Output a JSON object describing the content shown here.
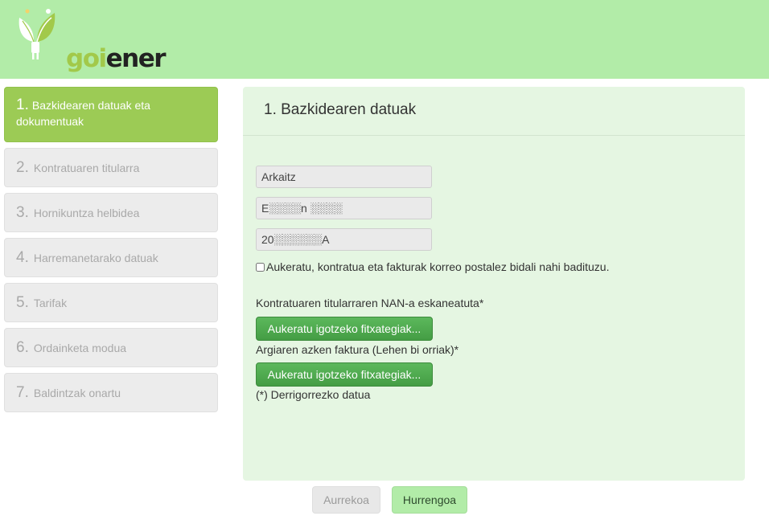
{
  "header": {
    "logo_text_goi": "goi",
    "logo_text_ener": "ener",
    "brand_colors": {
      "green_light": "#b2eca8",
      "green_logo": "#a2c94a",
      "active_step": "#9ccb55"
    }
  },
  "steps": [
    {
      "num": "1.",
      "label": "Bazkidearen datuak eta dokumentuak",
      "active": true
    },
    {
      "num": "2.",
      "label": "Kontratuaren titularra",
      "active": false
    },
    {
      "num": "3.",
      "label": "Hornikuntza helbidea",
      "active": false
    },
    {
      "num": "4.",
      "label": "Harremanetarako datuak",
      "active": false
    },
    {
      "num": "5.",
      "label": "Tarifak",
      "active": false
    },
    {
      "num": "6.",
      "label": "Ordainketa modua",
      "active": false
    },
    {
      "num": "7.",
      "label": "Baldintzak onartu",
      "active": false
    }
  ],
  "form": {
    "title": "1. Bazkidearen datuak",
    "name_value": "Arkaitz",
    "surname_value": "E░░░░n ░░░░",
    "id_value": "20░░░░░░A",
    "postal_checkbox_label": "Aukeratu, kontratua eta fakturak korreo postalez bidali nahi badituzu.",
    "nan_label": "Kontratuaren titularraren NAN-a eskaneatuta*",
    "upload1_label": "Aukeratu igotzeko fitxategiak...",
    "invoice_label": "Argiaren azken faktura (Lehen bi orriak)*",
    "upload2_label": "Aukeratu igotzeko fitxategiak...",
    "required_note": "(*) Derrigorrezko datua"
  },
  "nav": {
    "prev_label": "Aurrekoa",
    "next_label": "Hurrengoa"
  }
}
